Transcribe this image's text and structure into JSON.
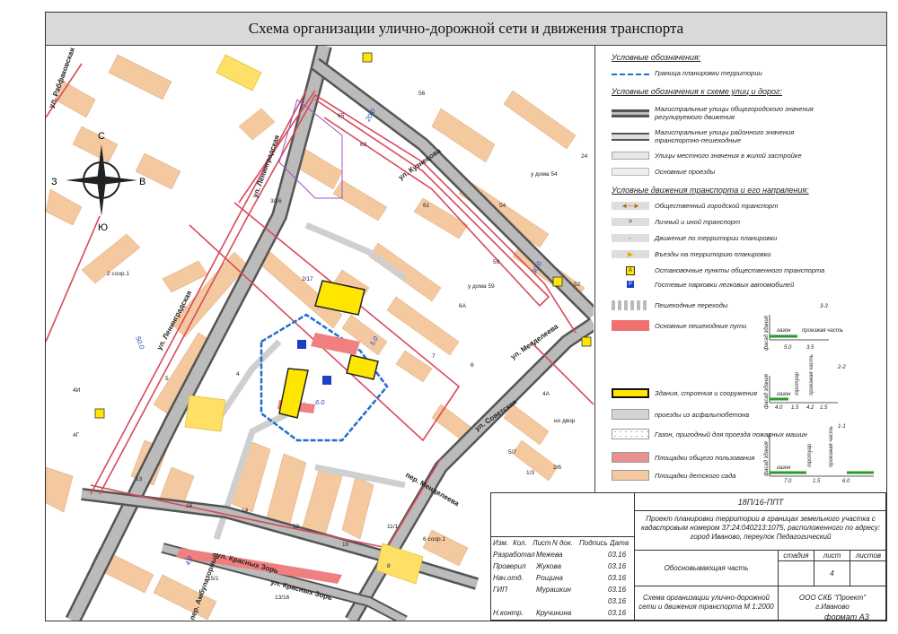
{
  "title": "Схема организации улично-дорожной сети и движения транспорта",
  "compass": {
    "n": "С",
    "s": "Ю",
    "w": "З",
    "e": "В"
  },
  "streets": {
    "rabfakovskaya": "ул. Рабфаковская",
    "leningradskaya_upper": "ул. Ленинградская",
    "leningradskaya_lower": "ул. Ленинградская",
    "kuznetsov": "ул. Кузнецова",
    "mendeleeva": "ул. Менделеева",
    "mendeleeva_lane": "пер. Менделеева",
    "sovetskaya": "ул. Советская",
    "krasnykh_zor_1": "ул. Красных Зорь",
    "krasnykh_zor_2": "ул. Красных Зорь",
    "ambulatorny": "пер. Амбулаторный"
  },
  "house_numbers": [
    "65",
    "63",
    "56",
    "24",
    "3/16",
    "61",
    "54",
    "52",
    "2 соор.1",
    "59",
    "у дома 59",
    "у дома 54",
    "2/17",
    "6А",
    "5",
    "4",
    "6",
    "7",
    "4А",
    "13",
    "16",
    "14",
    "12",
    "10",
    "11/1",
    "8",
    "6 соор.1",
    "5/7",
    "1/3",
    "2/6",
    "15/1",
    "13/16",
    "4И",
    "4Г",
    "но двор"
  ],
  "dimensions": [
    "50.0",
    "20.0",
    "30.0",
    "6.0",
    "5.0",
    "4.0"
  ],
  "legend": {
    "h1": "Условные обозначения:",
    "boundary": "Граница планировки территории",
    "h2": "Условные обозначения к схеме улиц и дорог:",
    "main_city": "Магистральные улицы общегородского значения регулируемого движения",
    "main_district": "Магистральные улицы районного значения транспортно-пешеходные",
    "local": "Улицы местного значения в жилой застройке",
    "driveways": "Основные проезды",
    "h3": "Условные движения транспорта и его напрвления:",
    "public_transport": "Общественный городской транспорт",
    "personal": "Личный и иной транспорт",
    "territory_move": "Движение по территории планировки",
    "entries": "Въезды на территорию планировки",
    "stop_marker": "А",
    "stops": "Остановочные пункты общественного транспорта",
    "parking_marker": "Р",
    "parking": "Гостевые парковки легковых автомобилей",
    "crossings": "Пешеходные переходы",
    "paths": "Основные пешеходные пути",
    "buildings": "Здания, строения и сооружения",
    "asphalt": "проезды из асфальтобетона",
    "lawn": "Газон, пригодный для проезда пожарных машин",
    "public_areas": "Площадки общего пользования",
    "kindergarten": "Площадки детского сада"
  },
  "sections": {
    "s33": {
      "label": "3-3",
      "facade": "фасад здания",
      "lawn": "газон",
      "road": "проезжая часть",
      "dims": [
        "5.0",
        "3.5"
      ]
    },
    "s22": {
      "label": "2-2",
      "facade": "фасад здания",
      "lawn": "газон",
      "sidewalk": "тротуар",
      "road": "проезжая часть",
      "dims": [
        "4.0",
        "1.5",
        "4.2",
        "1.5"
      ]
    },
    "s11": {
      "label": "1-1",
      "facade": "фасад здания",
      "lawn": "газон",
      "sidewalk": "тротуар",
      "road": "проезжая часть",
      "dims": [
        "7.0",
        "1.5",
        "6.0"
      ]
    }
  },
  "stamp": {
    "code": "18П/16-ППТ",
    "project": "Проект планировки территории в границах земельного участка с кадастровым номером 37:24:040213:1075, расположенного по адресу: город Иваново, переулок Педагогический",
    "headers": [
      "Изм.",
      "Кол.",
      "Лист",
      "N док.",
      "Подпись",
      "Дата"
    ],
    "rows": [
      {
        "role": "Разработал",
        "name": "Межева",
        "date": "03.16"
      },
      {
        "role": "Проверил",
        "name": "Жукова",
        "date": "03.16"
      },
      {
        "role": "Нач.отд.",
        "name": "Рощина",
        "date": "03.16"
      },
      {
        "role": "ГИП",
        "name": "Мурашкин",
        "date": "03.16"
      },
      {
        "role": "",
        "name": "",
        "date": "03.16"
      },
      {
        "role": "Н.контр.",
        "name": "Кручинина",
        "date": "03.16"
      }
    ],
    "part": "Обосновывающая часть",
    "stage_h": "стадия",
    "sheet_h": "лист",
    "sheets_h": "листов",
    "stage": "",
    "sheet": "4",
    "sheets": "",
    "drawing": "Схема организации улично-дорожной сети и движения транспорта М 1:2000",
    "org": "ООО СКБ \"Проект\" г.Иваново"
  },
  "format": "формат А3"
}
